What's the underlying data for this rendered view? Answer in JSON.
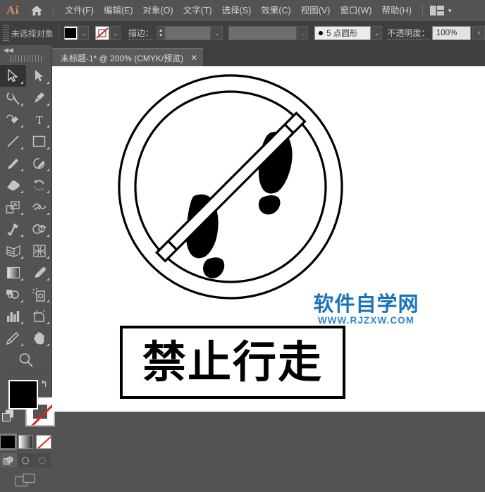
{
  "app": {
    "name": "Ai",
    "logo_color": "#d98b5f",
    "home_icon": "home-icon"
  },
  "menubar": {
    "items": [
      {
        "label": "文件(F)",
        "name": "menu-file"
      },
      {
        "label": "编辑(E)",
        "name": "menu-edit"
      },
      {
        "label": "对象(O)",
        "name": "menu-object"
      },
      {
        "label": "文字(T)",
        "name": "menu-type"
      },
      {
        "label": "选择(S)",
        "name": "menu-select"
      },
      {
        "label": "效果(C)",
        "name": "menu-effect"
      },
      {
        "label": "视图(V)",
        "name": "menu-view"
      },
      {
        "label": "窗口(W)",
        "name": "menu-window"
      },
      {
        "label": "帮助(H)",
        "name": "menu-help"
      }
    ],
    "arrange_icon": "arrange-documents-icon",
    "arrange_chevron": "▾"
  },
  "controlbar": {
    "selection_status": "未选择对象",
    "fill_label": "fill-swatch",
    "fill_color": "#000000",
    "stroke_label": "stroke-swatch",
    "stroke_color": "none",
    "stroke_weight_label": "描边：",
    "stroke_weight_value": "",
    "style_value": "",
    "brush_value": "5 点圆形",
    "opacity_label": "不透明度：",
    "opacity_value": "100%",
    "chevron": "⌄",
    "more_arrow": "›",
    "stepper_up": "▲",
    "stepper_down": "▼"
  },
  "tabbar": {
    "tab_title": "未标题-1* @ 200% (CMYK/预览)",
    "close_glyph": "✕"
  },
  "toolpanel": {
    "collapse_glyph": "◀◀",
    "tools": [
      {
        "name": "selection-tool",
        "selected": true
      },
      {
        "name": "direct-selection-tool",
        "selected": false
      },
      {
        "name": "magic-wand-tool",
        "selected": false
      },
      {
        "name": "pen-tool",
        "selected": false
      },
      {
        "name": "curvature-tool",
        "selected": false
      },
      {
        "name": "type-tool",
        "selected": false
      },
      {
        "name": "line-segment-tool",
        "selected": false
      },
      {
        "name": "rectangle-tool",
        "selected": false
      },
      {
        "name": "paintbrush-tool",
        "selected": false
      },
      {
        "name": "shaper-tool",
        "selected": false
      },
      {
        "name": "eraser-tool",
        "selected": false
      },
      {
        "name": "rotate-tool",
        "selected": false
      },
      {
        "name": "scale-tool",
        "selected": false
      },
      {
        "name": "width-tool",
        "selected": false
      },
      {
        "name": "free-transform-tool",
        "selected": false
      },
      {
        "name": "shape-builder-tool",
        "selected": false
      },
      {
        "name": "perspective-grid-tool",
        "selected": false
      },
      {
        "name": "mesh-tool",
        "selected": false
      },
      {
        "name": "gradient-tool",
        "selected": false
      },
      {
        "name": "eyedropper-tool",
        "selected": false
      },
      {
        "name": "blend-tool",
        "selected": false
      },
      {
        "name": "symbol-sprayer-tool",
        "selected": false
      },
      {
        "name": "column-graph-tool",
        "selected": false
      },
      {
        "name": "artboard-tool",
        "selected": false
      },
      {
        "name": "slice-tool",
        "selected": false
      },
      {
        "name": "hand-tool",
        "selected": false
      },
      {
        "name": "zoom-tool",
        "selected": false
      }
    ],
    "color": {
      "fill_color": "#000000",
      "stroke_color": "#ffffff",
      "swap_glyph": "↰",
      "modes": [
        {
          "name": "color-mode-swatch",
          "type": "black",
          "selected": true
        },
        {
          "name": "gradient-mode-swatch",
          "type": "gradient",
          "selected": false
        },
        {
          "name": "none-mode-swatch",
          "type": "none",
          "selected": false
        }
      ],
      "draw_modes": [
        {
          "name": "draw-normal-button",
          "selected": true
        },
        {
          "name": "draw-behind-button",
          "selected": false
        },
        {
          "name": "draw-inside-button",
          "selected": false
        }
      ],
      "screen_mode": "change-screen-mode-button"
    }
  },
  "canvas": {
    "artwork_name": "no-walking-sign-artwork",
    "artwork_description": "prohibition circle with two footprints and diagonal bar",
    "textbox_label": "禁止行走",
    "watermark": {
      "cn": "软件自学网",
      "en": "WWW.RJZXW.COM",
      "color": "#1a72bd"
    }
  }
}
